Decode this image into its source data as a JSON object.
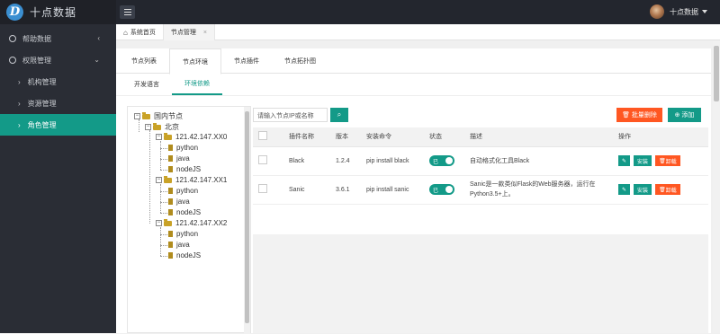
{
  "app": {
    "title": "十点数据",
    "logo_letter": "D"
  },
  "user": {
    "name": "十点数据"
  },
  "sidebar": {
    "items": [
      {
        "label": "帮助数据",
        "icon": "gear-icon"
      },
      {
        "label": "权限管理",
        "icon": "gear-icon"
      }
    ],
    "subitems": [
      "机构管理",
      "资源管理",
      "角色管理"
    ]
  },
  "page_tabs": [
    {
      "label": "系统首页"
    },
    {
      "label": "节点管理",
      "close": "×"
    }
  ],
  "tabs": [
    "节点列表",
    "节点环境",
    "节点插件",
    "节点拓扑图"
  ],
  "subtabs": [
    "开发语言",
    "环境依赖"
  ],
  "tree": {
    "root": "国内节点",
    "region": "北京",
    "nodes": [
      {
        "label": "121.42.147.XX0",
        "children": [
          "python",
          "java",
          "nodeJS"
        ]
      },
      {
        "label": "121.42.147.XX1",
        "children": [
          "python",
          "java",
          "nodeJS"
        ]
      },
      {
        "label": "121.42.147.XX2",
        "children": [
          "python",
          "java",
          "nodeJS"
        ]
      }
    ]
  },
  "toolbar": {
    "search_placeholder": "请输入节点IP或名称",
    "batch_delete": "批量删除",
    "add": "添加"
  },
  "table": {
    "headers": [
      "插件名称",
      "版本",
      "安装命令",
      "状态",
      "描述",
      "操作"
    ],
    "rows": [
      {
        "name": "Black",
        "version": "1.2.4",
        "cmd": "pip install black",
        "status": "已",
        "desc": "自动格式化工具Black"
      },
      {
        "name": "Sanic",
        "version": "3.6.1",
        "cmd": "pip install sanic",
        "status": "已",
        "desc": "Sanic是一款类似Flask的Web服务器，运行在Python3.5+上。"
      }
    ],
    "row_actions": {
      "install": "安装",
      "delete": "卸载"
    }
  },
  "colors": {
    "accent": "#139a88",
    "danger": "#ff5722",
    "topbar": "#23262e",
    "sidebar": "#2a2d35"
  }
}
